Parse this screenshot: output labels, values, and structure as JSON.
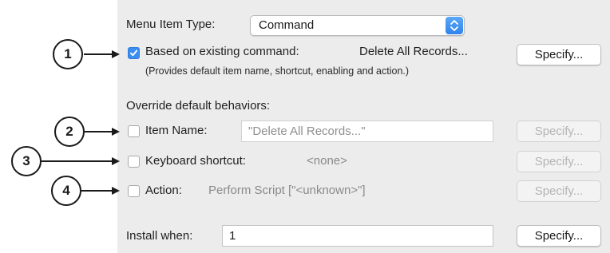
{
  "menu_item_type": {
    "label": "Menu Item Type:",
    "value": "Command"
  },
  "based_on": {
    "label": "Based on existing command:",
    "checked": true,
    "command_name": "Delete All Records...",
    "note": "(Provides default item name, shortcut, enabling and action.)",
    "specify_label": "Specify..."
  },
  "override_heading": "Override default behaviors:",
  "item_name": {
    "label": "Item Name:",
    "value": "\"Delete All Records...\"",
    "checked": false,
    "specify_label": "Specify..."
  },
  "keyboard_shortcut": {
    "label": "Keyboard shortcut:",
    "value": "<none>",
    "checked": false,
    "specify_label": "Specify..."
  },
  "action": {
    "label": "Action:",
    "value": "Perform Script [\"<unknown>\"]",
    "checked": false,
    "specify_label": "Specify..."
  },
  "install_when": {
    "label": "Install when:",
    "value": "1",
    "specify_label": "Specify..."
  },
  "callouts": [
    "1",
    "2",
    "3",
    "4"
  ],
  "colors": {
    "panel": "#ececec",
    "accent": "#3b8eed"
  }
}
